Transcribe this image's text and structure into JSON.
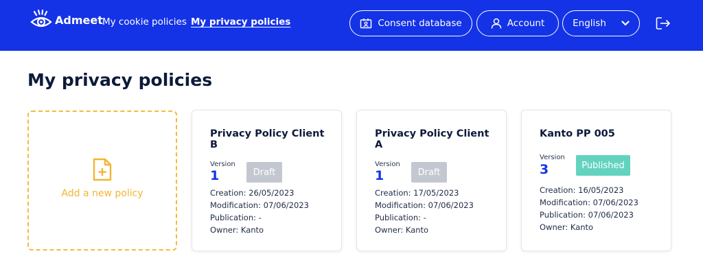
{
  "header": {
    "brand": "Admeet",
    "nav": [
      {
        "label": "My cookie policies",
        "active": false
      },
      {
        "label": "My privacy policies",
        "active": true
      }
    ],
    "consent_label": "Consent database",
    "account_label": "Account",
    "language": "English"
  },
  "page": {
    "title": "My privacy policies"
  },
  "add_card": {
    "label": "Add a new policy"
  },
  "version_label": "Version",
  "policies": [
    {
      "title": "Privacy Policy Client B",
      "version": "1",
      "status": "Draft",
      "creation": "Creation: 26/05/2023",
      "modification": "Modification: 07/06/2023",
      "publication": "Publication: -",
      "owner": "Owner: Kanto"
    },
    {
      "title": "Privacy Policy Client A",
      "version": "1",
      "status": "Draft",
      "creation": "Creation: 17/05/2023",
      "modification": "Modification: 07/06/2023",
      "publication": "Publication: -",
      "owner": "Owner: Kanto"
    },
    {
      "title": "Kanto PP 005",
      "version": "3",
      "status": "Published",
      "creation": "Creation: 16/05/2023",
      "modification": "Modification: 07/06/2023",
      "publication": "Publication: 07/06/2023",
      "owner": "Owner: Kanto"
    }
  ],
  "colors": {
    "header_bg": "#1433e6",
    "accent_yellow": "#f2b531",
    "draft_badge": "#c3c8d0",
    "published_badge": "#63d3bf"
  }
}
